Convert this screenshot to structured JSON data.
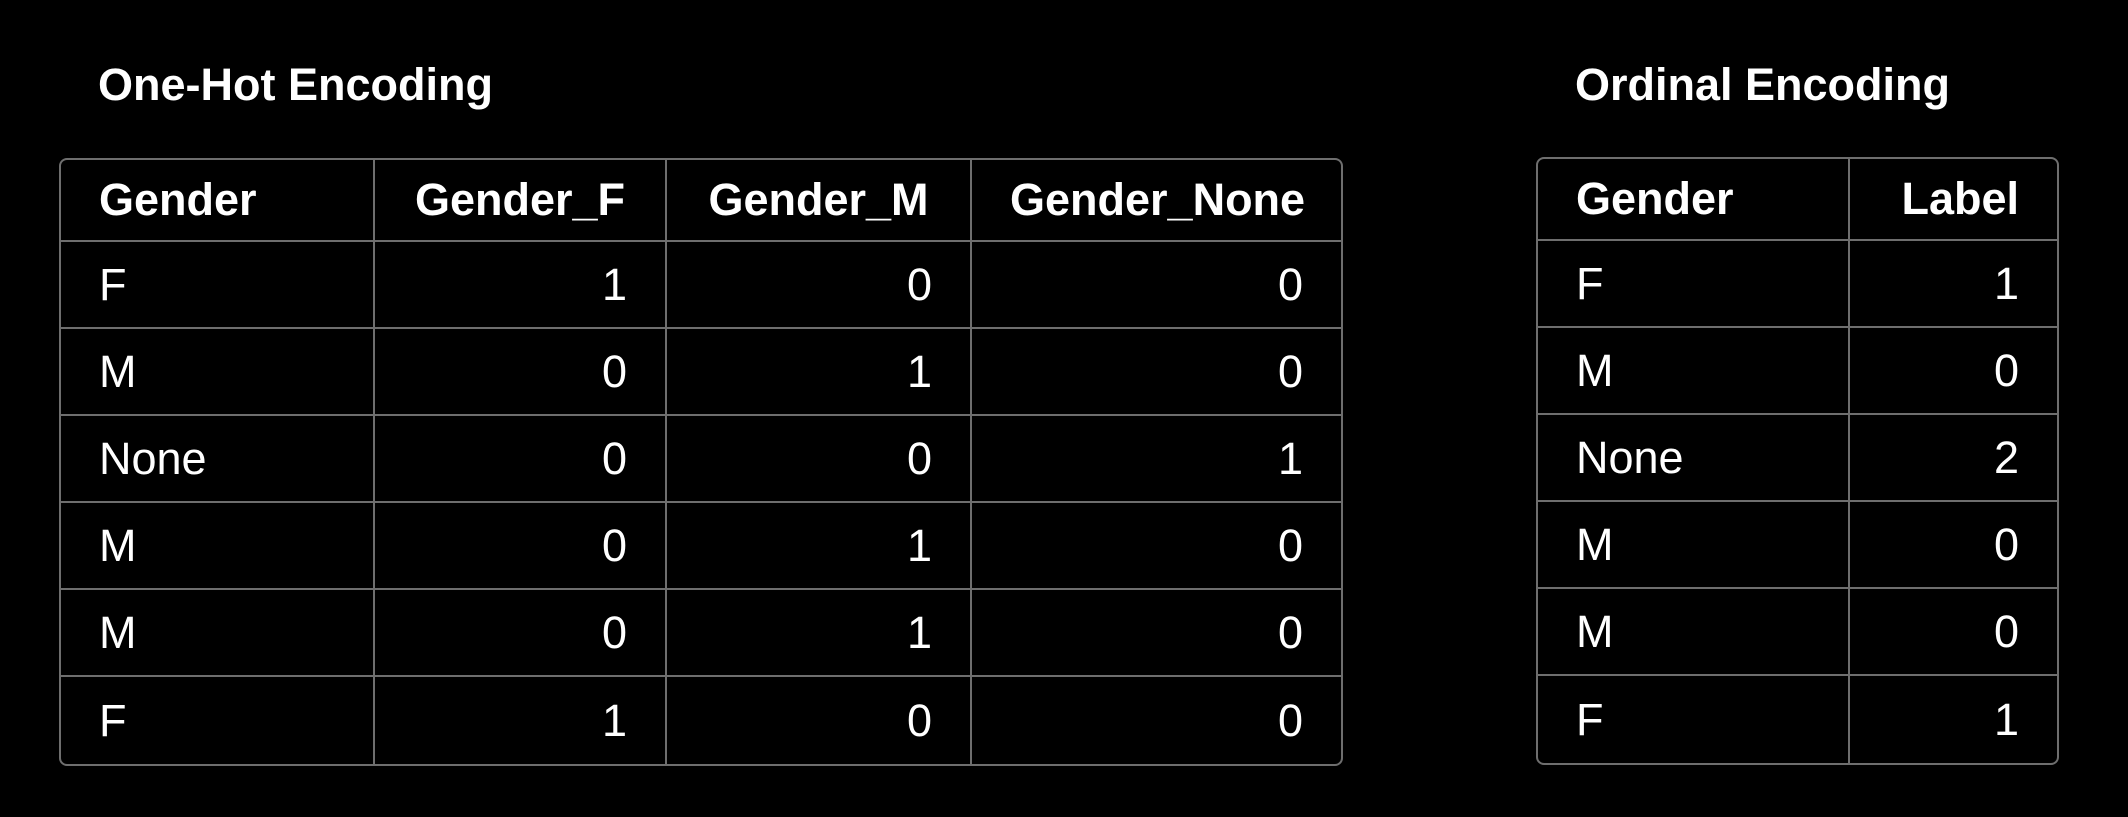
{
  "one_hot": {
    "title": "One-Hot Encoding",
    "headers": [
      "Gender",
      "Gender_F",
      "Gender_M",
      "Gender_None"
    ],
    "rows": [
      [
        "F",
        "1",
        "0",
        "0"
      ],
      [
        "M",
        "0",
        "1",
        "0"
      ],
      [
        "None",
        "0",
        "0",
        "1"
      ],
      [
        "M",
        "0",
        "1",
        "0"
      ],
      [
        "M",
        "0",
        "1",
        "0"
      ],
      [
        "F",
        "1",
        "0",
        "0"
      ]
    ]
  },
  "ordinal": {
    "title": "Ordinal Encoding",
    "headers": [
      "Gender",
      "Label"
    ],
    "rows": [
      [
        "F",
        "1"
      ],
      [
        "M",
        "0"
      ],
      [
        "None",
        "2"
      ],
      [
        "M",
        "0"
      ],
      [
        "M",
        "0"
      ],
      [
        "F",
        "1"
      ]
    ]
  },
  "colors": {
    "background": "#000000",
    "text": "#ffffff",
    "grid": "#6e6e6e"
  }
}
